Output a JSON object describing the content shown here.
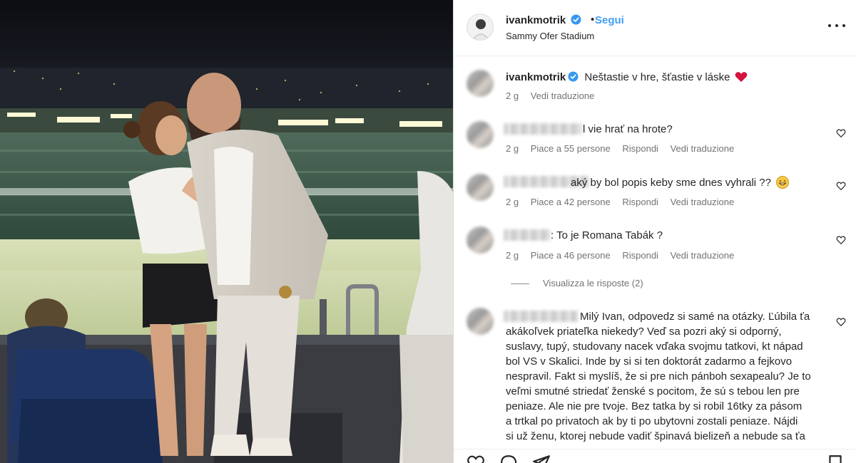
{
  "post": {
    "username": "ivankmotrik",
    "dot": "•",
    "follow_label": "Segui",
    "location": "Sammy Ofer Stadium"
  },
  "caption": {
    "username": "ivankmotrik",
    "text": "Neštastie v hre, šťastie v láske",
    "emoji": "heart-emoji",
    "time": "2 g",
    "translate": "Vedi traduzione"
  },
  "comments": [
    {
      "text": "l vie hrať na hrote?",
      "time": "2 g",
      "likes": "Piace a 55 persone",
      "reply": "Rispondi",
      "translate": "Vedi traduzione"
    },
    {
      "text": "aký by bol popis keby sme dnes vyhrali ??",
      "emoji": "grin-emoji",
      "time": "2 g",
      "likes": "Piace a 42 persone",
      "reply": "Rispondi",
      "translate": "Vedi traduzione"
    },
    {
      "text": ": To je Romana Tabák ?",
      "time": "2 g",
      "likes": "Piace a 46 persone",
      "reply": "Rispondi",
      "translate": "Vedi traduzione"
    }
  ],
  "view_replies": "Visualizza le risposte (2)",
  "long_comment": "Milý Ivan, odpovedz si samé na otázky. Ľúbila ťa\nakákoľvek priateľka niekedy? Veď sa pozri aký si odporný,\nsuslavy, tupý, studovany nacek vďaka svojmu tatkovi, kt nápad\nbol VS v Skalici. Inde by si si ten doktorát zadarmo a fejkovo\nnespravil. Fakt si myslíš, že si pre nich pánboh sexapealu? Je to\nveľmi smutné striedať ženské s pocitom, že sú s tebou len pre\npeniaze. Ale nie pre tvoje. Bez tatka by si robil 16tky za pásom\na trtkal po privatoch ak by ti po ubytovni zostali peniaze. Nájdi\nsi už ženu, ktorej nebude vadiť špinavá bielizeň a nebude sa ťa",
  "icons": {
    "verified": "verified-badge-icon",
    "more": "more-options-icon",
    "like": "heart-icon",
    "comment": "comment-icon",
    "share": "share-icon",
    "save": "bookmark-icon"
  },
  "colors": {
    "accent": "#3f9ff7",
    "verified": "#3897f0",
    "heart": "#d4143c",
    "muted": "#737373"
  }
}
